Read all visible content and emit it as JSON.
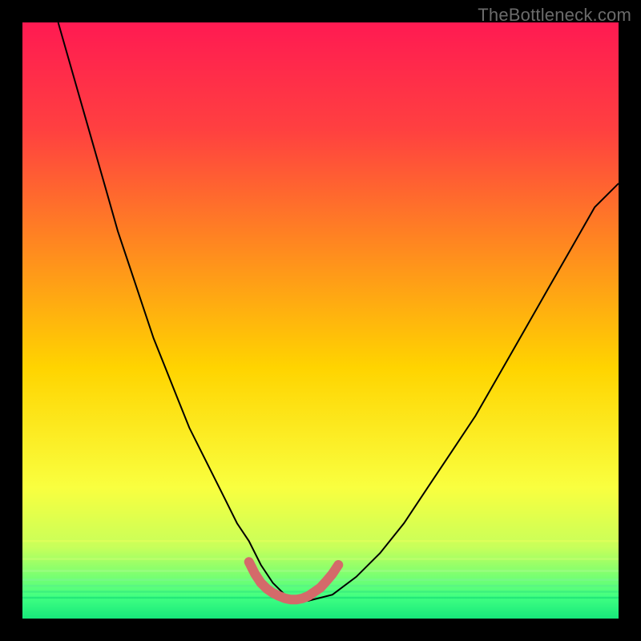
{
  "watermark": "TheBottleneck.com",
  "chart_data": {
    "type": "line",
    "title": "",
    "xlabel": "",
    "ylabel": "",
    "xlim": [
      0,
      100
    ],
    "ylim": [
      0,
      100
    ],
    "grid": false,
    "legend": false,
    "background": {
      "type": "vertical-gradient",
      "stops": [
        {
          "pos": 0.0,
          "color": "#ff1a52"
        },
        {
          "pos": 0.18,
          "color": "#ff4040"
        },
        {
          "pos": 0.38,
          "color": "#ff8a1f"
        },
        {
          "pos": 0.58,
          "color": "#ffd400"
        },
        {
          "pos": 0.78,
          "color": "#f9ff3f"
        },
        {
          "pos": 0.88,
          "color": "#c8ff5a"
        },
        {
          "pos": 0.965,
          "color": "#3fff82"
        },
        {
          "pos": 1.0,
          "color": "#17e87a"
        }
      ]
    },
    "series": [
      {
        "name": "bottleneck-curve",
        "stroke": "#000000",
        "stroke_width": 2,
        "x": [
          6,
          8,
          10,
          12,
          14,
          16,
          18,
          20,
          22,
          24,
          26,
          28,
          30,
          32,
          34,
          36,
          38,
          40,
          42,
          44,
          46,
          48,
          52,
          56,
          60,
          64,
          68,
          72,
          76,
          80,
          84,
          88,
          92,
          96,
          100
        ],
        "y": [
          100,
          93,
          86,
          79,
          72,
          65,
          59,
          53,
          47,
          42,
          37,
          32,
          28,
          24,
          20,
          16,
          13,
          9,
          6,
          4,
          3,
          3,
          4,
          7,
          11,
          16,
          22,
          28,
          34,
          41,
          48,
          55,
          62,
          69,
          73
        ]
      },
      {
        "name": "optimal-range-marker",
        "stroke": "#d46a6a",
        "stroke_width": 12,
        "stroke_linecap": "round",
        "x": [
          38,
          39,
          40,
          41,
          42,
          43,
          44,
          45,
          46,
          47,
          48,
          49,
          50,
          51,
          52,
          53
        ],
        "y": [
          9.5,
          7.5,
          6.0,
          5.0,
          4.3,
          3.8,
          3.4,
          3.2,
          3.2,
          3.4,
          3.8,
          4.5,
          5.2,
          6.3,
          7.5,
          9.0
        ]
      }
    ],
    "bottom_bands": [
      {
        "y": 0.965,
        "color": "#0fd772"
      },
      {
        "y": 0.955,
        "color": "#30e77e"
      },
      {
        "y": 0.945,
        "color": "#55f08a"
      },
      {
        "y": 0.935,
        "color": "#7af794"
      },
      {
        "y": 0.92,
        "color": "#a4fd8d"
      },
      {
        "y": 0.9,
        "color": "#caff72"
      },
      {
        "y": 0.87,
        "color": "#e8ff5c"
      }
    ]
  }
}
